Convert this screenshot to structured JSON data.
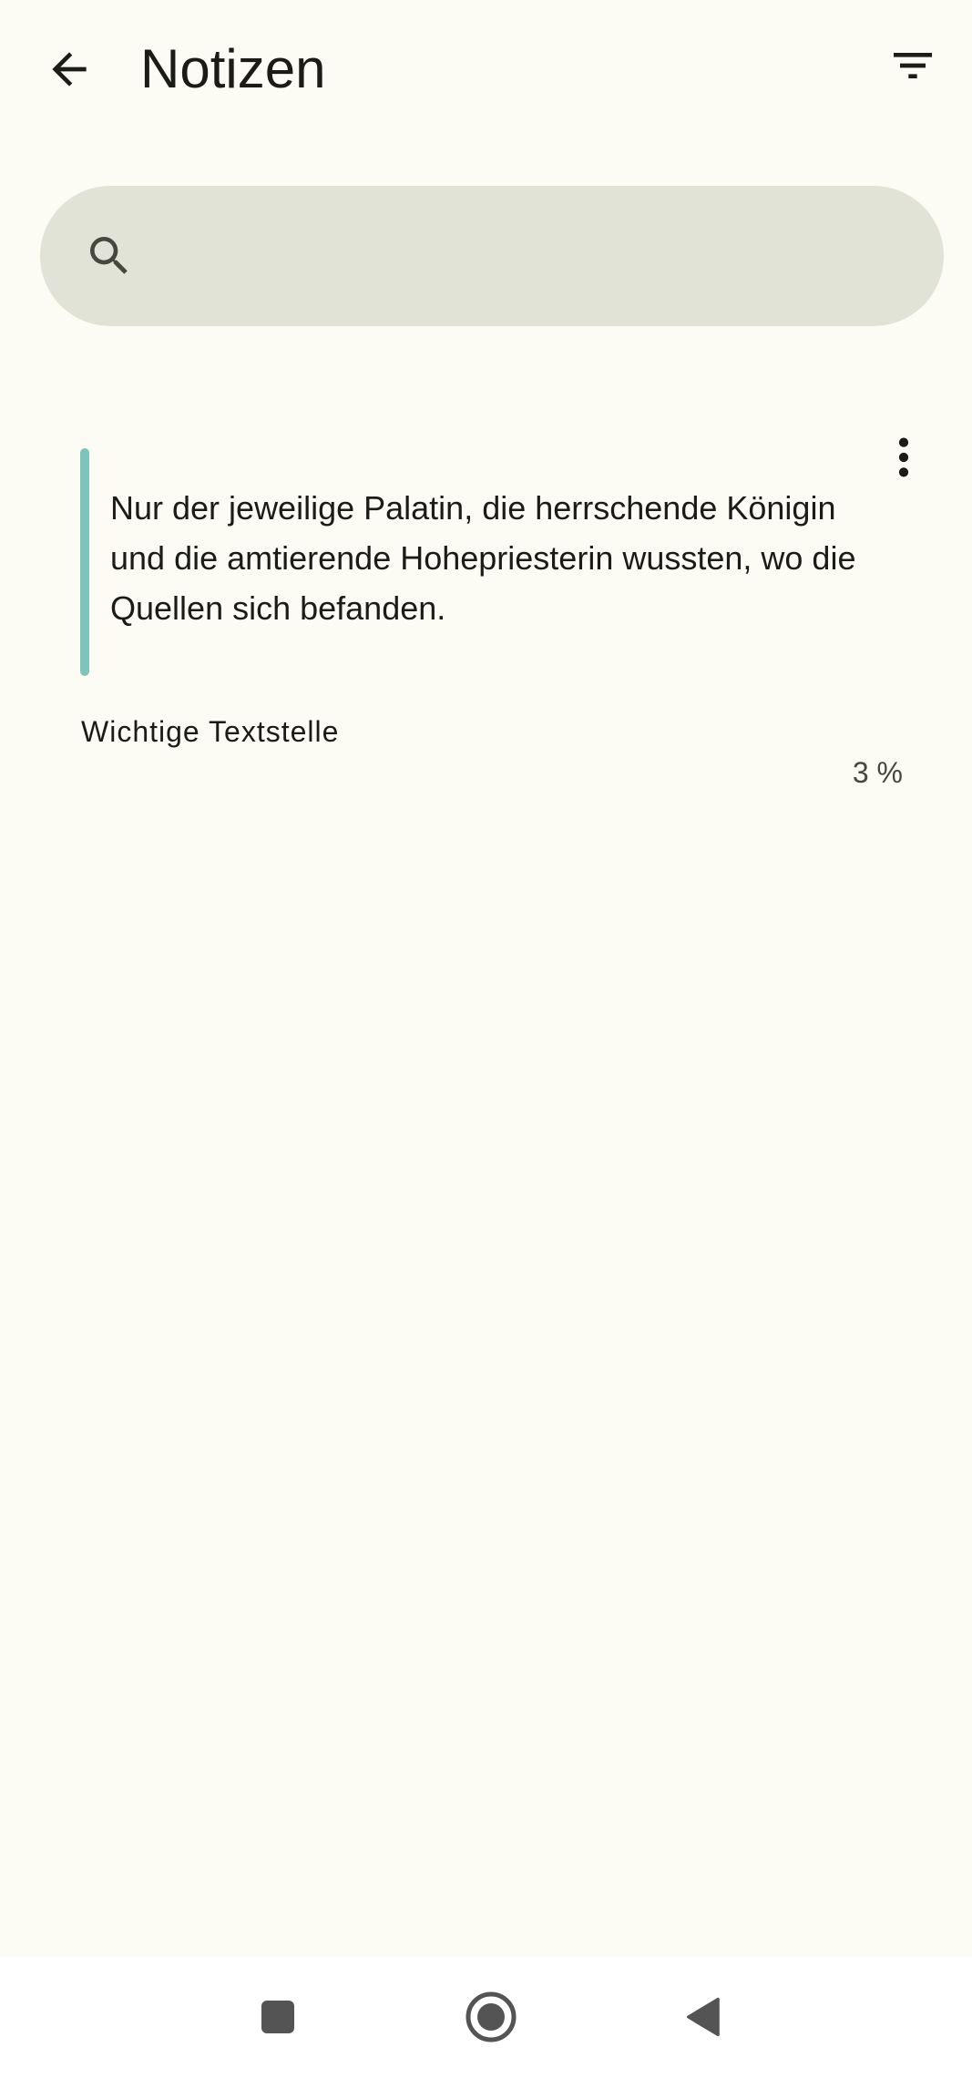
{
  "header": {
    "title": "Notizen",
    "back_icon": "arrow-left-icon",
    "filter_icon": "filter-list-icon"
  },
  "search": {
    "placeholder": "",
    "value": "",
    "icon": "search-icon"
  },
  "notes": [
    {
      "quote": "Nur der jeweilige Palatin, die herrschende Königin und die amtierende Hohepriesterin wussten, wo die Quellen sich befanden.",
      "label": "Wichtige Textstelle",
      "progress": "3 %",
      "highlight_color": "#7fc4bb",
      "menu_icon": "more-vert-icon"
    }
  ],
  "nav": {
    "recents_icon": "square-icon",
    "home_icon": "circle-icon",
    "back_icon": "triangle-back-icon"
  }
}
